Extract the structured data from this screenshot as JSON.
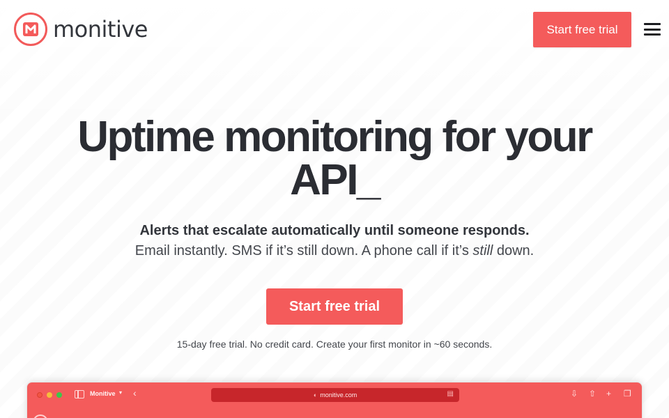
{
  "brand": {
    "name": "monitive",
    "accent": "#f45b5b"
  },
  "header": {
    "cta_label": "Start free trial",
    "menu_icon": "hamburger-icon"
  },
  "hero": {
    "title_line1": "Uptime monitoring for your",
    "title_line2": "API_",
    "subtitle_bold": "Alerts that escalate automatically until someone responds.",
    "subtitle_part1": "Email instantly. SMS if it’s still down. A phone call if it’s ",
    "subtitle_em": "still",
    "subtitle_part2": " down.",
    "cta_label": "Start free trial",
    "fine_print": "15-day free trial. No credit card. Create your first monitor in ~60 seconds."
  },
  "browser_preview": {
    "tab_title": "Monitive",
    "url": "monitive.com"
  }
}
